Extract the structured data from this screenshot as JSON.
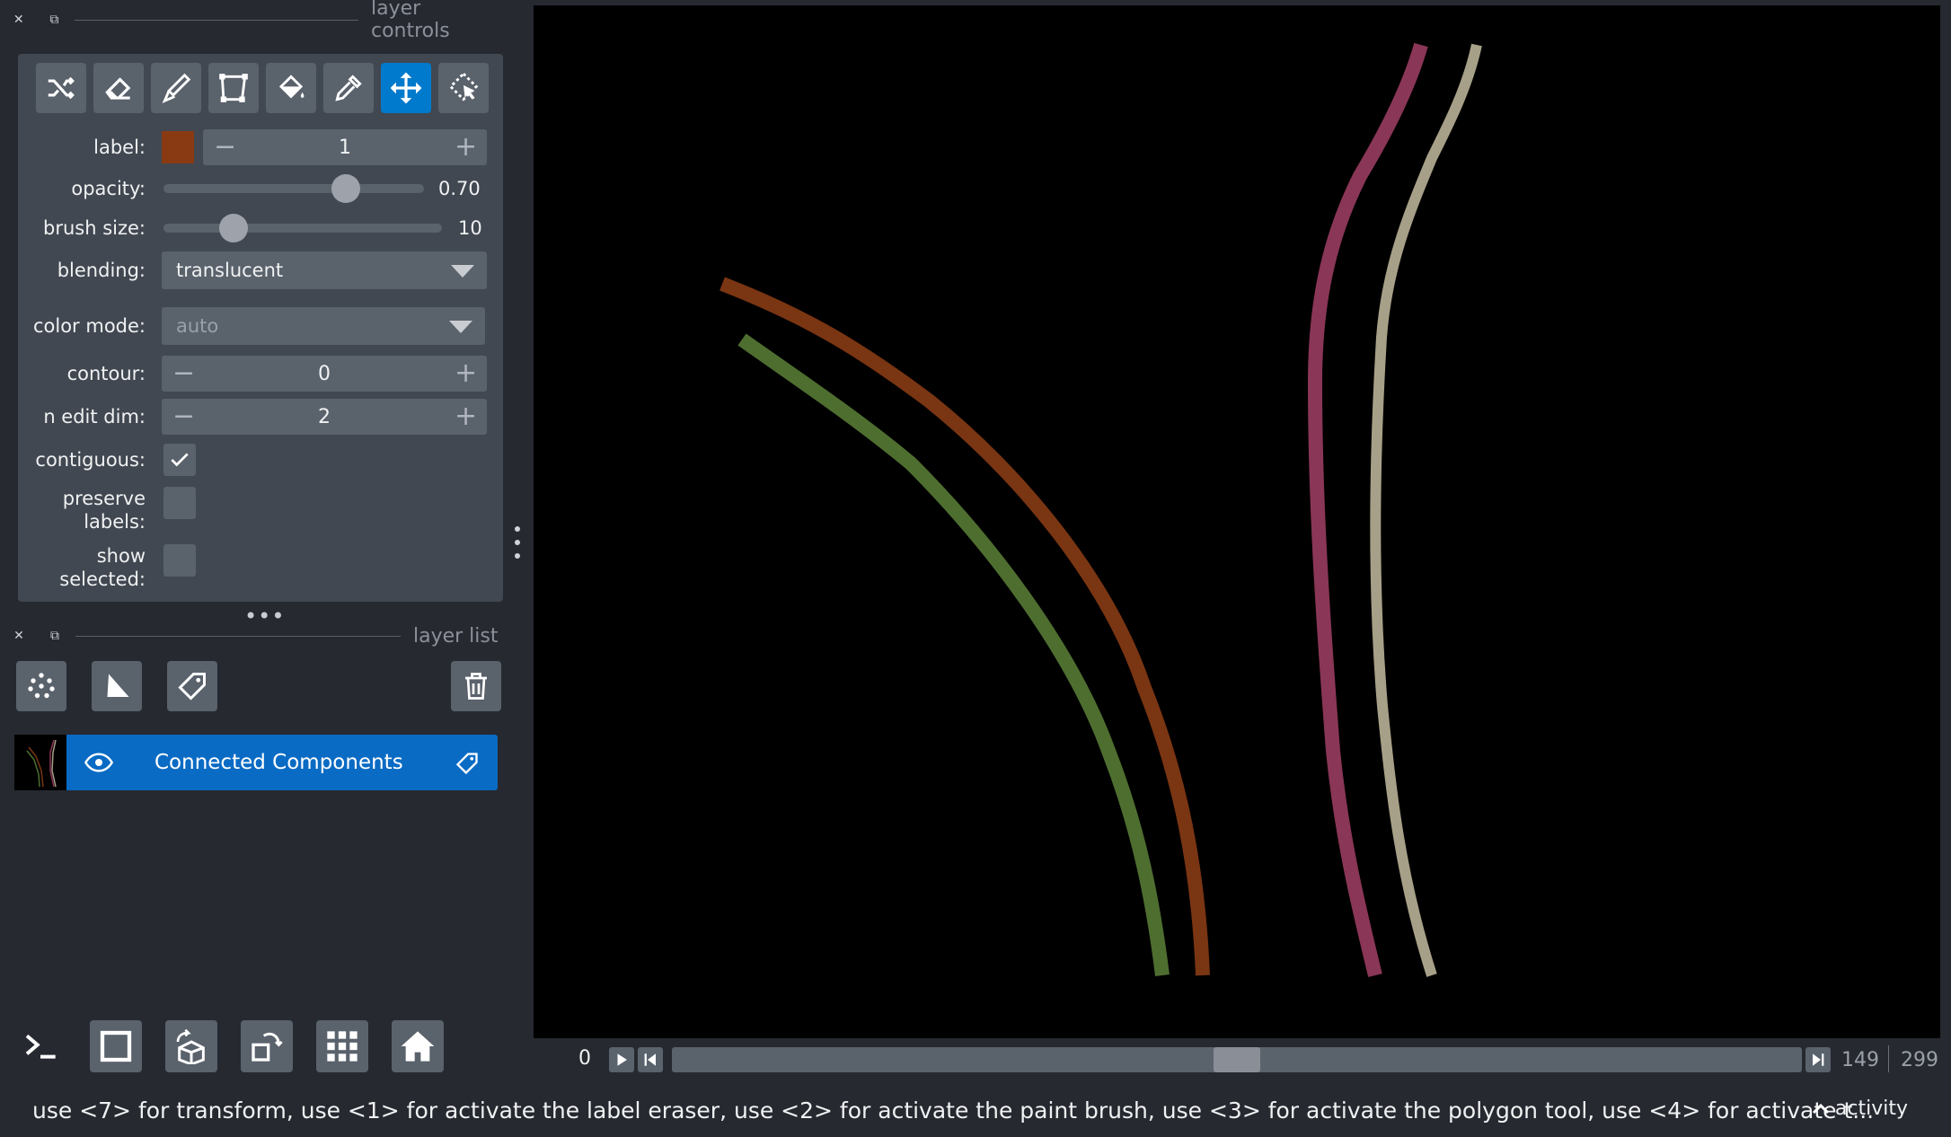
{
  "layer_controls": {
    "title": "layer controls",
    "tools": [
      {
        "name": "shuffle-colors",
        "active": false
      },
      {
        "name": "eraser",
        "active": false
      },
      {
        "name": "paint-brush",
        "active": false
      },
      {
        "name": "polygon",
        "active": false
      },
      {
        "name": "fill-bucket",
        "active": false
      },
      {
        "name": "color-picker",
        "active": false
      },
      {
        "name": "pan-zoom",
        "active": true
      },
      {
        "name": "transform",
        "active": false
      }
    ],
    "label": {
      "text": "label:",
      "value": "1",
      "color": "#8a3a12"
    },
    "opacity": {
      "text": "opacity:",
      "value": "0.70",
      "fraction": 0.7
    },
    "brush_size": {
      "text": "brush size:",
      "value": "10",
      "fraction": 0.25
    },
    "blending": {
      "text": "blending:",
      "value": "translucent"
    },
    "color_mode": {
      "text": "color mode:",
      "value": "auto"
    },
    "contour": {
      "text": "contour:",
      "value": "0"
    },
    "n_edit_dim": {
      "text": "n edit dim:",
      "value": "2"
    },
    "contiguous": {
      "text": "contiguous:",
      "checked": true
    },
    "preserve_labels": {
      "text1": "preserve",
      "text2": "labels:",
      "checked": false
    },
    "show_selected": {
      "text1": "show",
      "text2": "selected:",
      "checked": false
    }
  },
  "layer_list": {
    "title": "layer list",
    "layers": [
      {
        "name": "Connected Components",
        "visible": true,
        "selected": true
      }
    ]
  },
  "dims": {
    "current": "0",
    "frame": "149",
    "total": "299",
    "fraction": 0.5
  },
  "status_bar": {
    "text": "use <7> for transform, use <1> for activate the label eraser, use <2> for activate the paint brush, use <3> for activate the polygon tool, use <4> for activate t...",
    "activity": "activity"
  },
  "colors": {
    "accent": "#007acc",
    "label_brown": "#7a3512",
    "label_green": "#4e6e30",
    "label_magenta": "#8a3656",
    "label_tan": "#a7a088"
  }
}
